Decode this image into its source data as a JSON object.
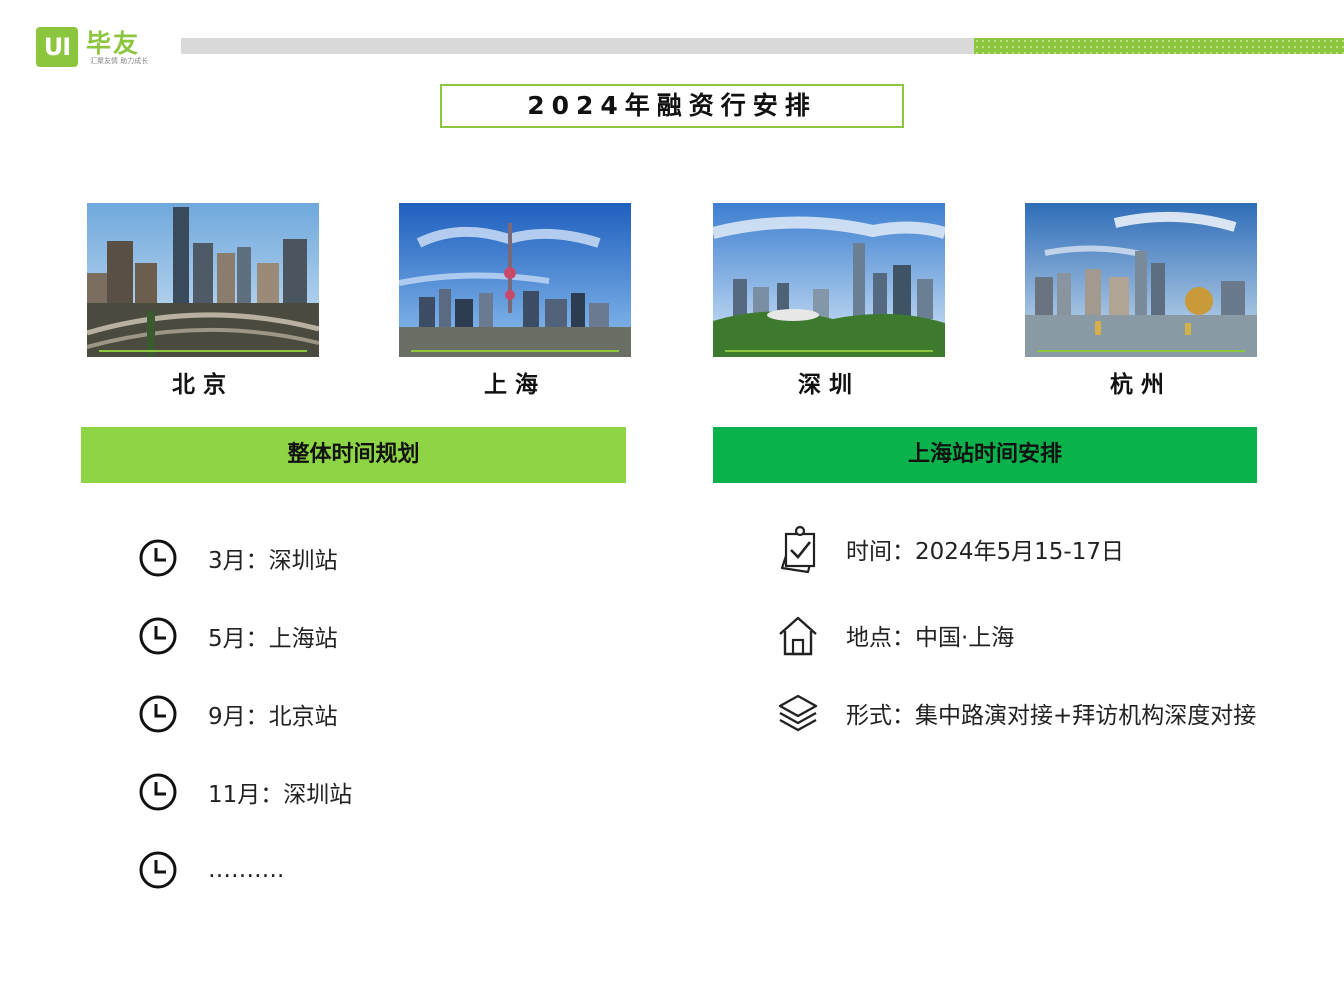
{
  "header": {
    "logo_mark": "UI",
    "logo_name": "毕友",
    "logo_slogan": "汇聚友情  助力成长",
    "title": "2024年融资行安排"
  },
  "cities": [
    {
      "name": "北京",
      "photo": "beijing-skyline"
    },
    {
      "name": "上海",
      "photo": "shanghai-skyline"
    },
    {
      "name": "深圳",
      "photo": "shenzhen-skyline"
    },
    {
      "name": "杭州",
      "photo": "hangzhou-skyline"
    }
  ],
  "overall": {
    "heading": "整体时间规划",
    "items": [
      {
        "text": "3月：深圳站",
        "icon": "clock-icon"
      },
      {
        "text": "5月：上海站",
        "icon": "clock-icon"
      },
      {
        "text": "9月：北京站",
        "icon": "clock-icon"
      },
      {
        "text": "11月：深圳站",
        "icon": "clock-icon"
      },
      {
        "text": "……….",
        "icon": "clock-icon"
      }
    ]
  },
  "shanghai": {
    "heading": "上海站时间安排",
    "items": [
      {
        "text": "时间：2024年5月15-17日",
        "icon": "clipboard-check-icon"
      },
      {
        "text": "地点：中国·上海",
        "icon": "home-icon"
      },
      {
        "text": "形式：集中路演对接+拜访机构深度对接",
        "icon": "layers-icon"
      }
    ]
  },
  "colors": {
    "brand_green": "#8cc63f",
    "left_header": "#8dd545",
    "right_header": "#0bb24b",
    "header_bar_gray": "#d9d9d9"
  }
}
